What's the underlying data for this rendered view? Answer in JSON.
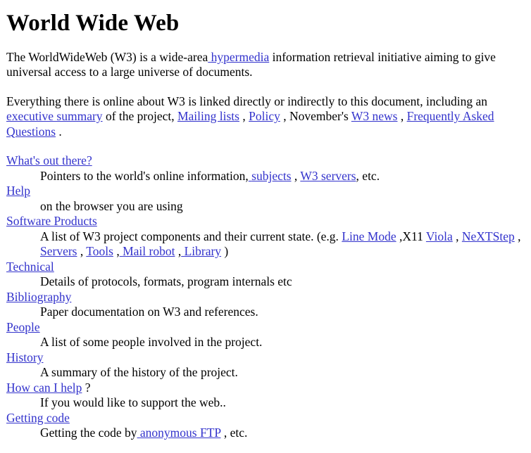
{
  "document": {
    "title": "World Wide Web",
    "link_color": "#3333cc",
    "text_color": "#000000",
    "background_color": "#ffffff"
  },
  "intro": {
    "t1": "The WorldWideWeb (W3) is a wide-area",
    "link_hypermedia": "hypermedia",
    "t2": " information retrieval initiative aiming to give universal access to a large universe of documents."
  },
  "everything": {
    "t1": "Everything there is online about W3 is linked directly or indirectly to this document, including an ",
    "link_executive_summary": "executive summary",
    "t2": " of the project, ",
    "link_mailing_lists": "Mailing lists",
    "t3": " , ",
    "link_policy": "Policy",
    "t4": " , November's ",
    "link_w3_news": "W3 news",
    "t5": " , ",
    "link_faq": "Frequently Asked Questions",
    "t6": " ."
  },
  "index": {
    "entries": [
      {
        "term_link": "What's out there?",
        "term_suffix": "",
        "desc_parts": [
          {
            "type": "text",
            "value": "Pointers to the world's online information,"
          },
          {
            "type": "link",
            "value": "subjects",
            "lead_space": true
          },
          {
            "type": "text",
            "value": " , "
          },
          {
            "type": "link",
            "value": "W3 servers",
            "lead_space": false
          },
          {
            "type": "text",
            "value": ", etc."
          }
        ]
      },
      {
        "term_link": "Help",
        "term_suffix": "",
        "desc_parts": [
          {
            "type": "text",
            "value": "on the browser you are using"
          }
        ]
      },
      {
        "term_link": "Software Products",
        "term_suffix": "",
        "desc_parts": [
          {
            "type": "text",
            "value": "A list of W3 project components and their current state. (e.g. "
          },
          {
            "type": "link",
            "value": "Line Mode",
            "lead_space": false
          },
          {
            "type": "text",
            "value": " ,X11 "
          },
          {
            "type": "link",
            "value": "Viola",
            "lead_space": false
          },
          {
            "type": "text",
            "value": " , "
          },
          {
            "type": "link",
            "value": "NeXTStep",
            "lead_space": false
          },
          {
            "type": "text",
            "value": " , "
          },
          {
            "type": "link",
            "value": "Servers",
            "lead_space": false
          },
          {
            "type": "text",
            "value": " , "
          },
          {
            "type": "link",
            "value": "Tools",
            "lead_space": false
          },
          {
            "type": "text",
            "value": " ,"
          },
          {
            "type": "link",
            "value": "Mail robot",
            "lead_space": true
          },
          {
            "type": "text",
            "value": " ,"
          },
          {
            "type": "link",
            "value": "Library",
            "lead_space": true
          },
          {
            "type": "text",
            "value": " )"
          }
        ]
      },
      {
        "term_link": "Technical",
        "term_suffix": "",
        "desc_parts": [
          {
            "type": "text",
            "value": "Details of protocols, formats, program internals etc"
          }
        ]
      },
      {
        "term_link": "Bibliography",
        "term_suffix": "",
        "desc_parts": [
          {
            "type": "text",
            "value": "Paper documentation on W3 and references."
          }
        ]
      },
      {
        "term_link": "People",
        "term_suffix": "",
        "desc_parts": [
          {
            "type": "text",
            "value": "A list of some people involved in the project."
          }
        ]
      },
      {
        "term_link": "History",
        "term_suffix": "",
        "desc_parts": [
          {
            "type": "text",
            "value": "A summary of the history of the project."
          }
        ]
      },
      {
        "term_link": "How can I help",
        "term_suffix": " ?",
        "desc_parts": [
          {
            "type": "text",
            "value": "If you would like to support the web.."
          }
        ]
      },
      {
        "term_link": "Getting code",
        "term_suffix": "",
        "desc_parts": [
          {
            "type": "text",
            "value": "Getting the code by"
          },
          {
            "type": "link",
            "value": "anonymous FTP",
            "lead_space": true
          },
          {
            "type": "text",
            "value": " , etc."
          }
        ]
      }
    ]
  }
}
